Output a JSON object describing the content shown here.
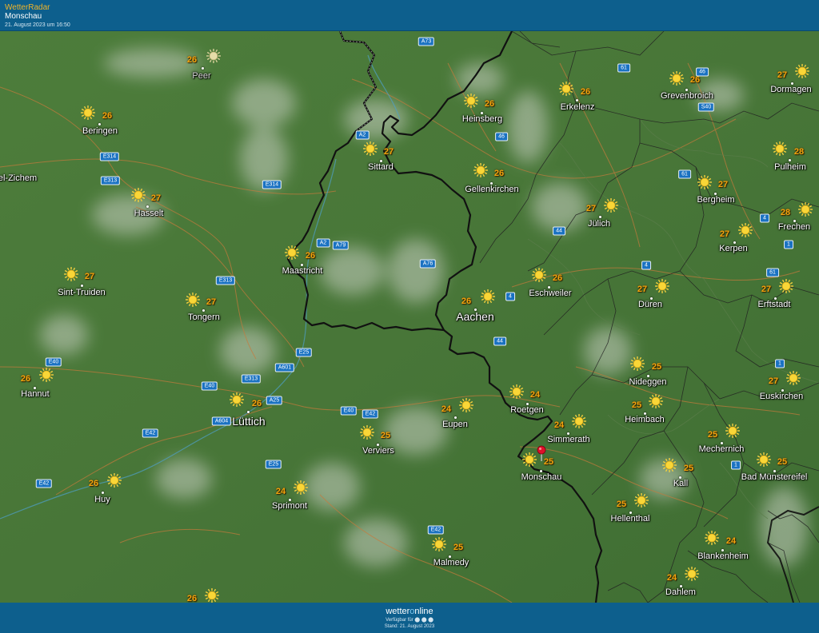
{
  "header": {
    "brand": "WetterRadar",
    "location": "Monschau",
    "date": "21. August 2023 um 16:50"
  },
  "footer": {
    "logo_a": "wetter",
    "logo_b": "o",
    "logo_c": "nline",
    "available": "Verfügbar für ⬤ ⬤ ⬤",
    "stand": "Stand: 21. August 2023"
  },
  "icons": {
    "sun": "sun-icon",
    "pin": "location-pin-icon"
  },
  "colors": {
    "map_green": "#4a7a3a",
    "temp": "#f3a20d",
    "road_badge": "#1a72c2",
    "header": "#0d5f8d",
    "pin": "#e0102a"
  },
  "cities": [
    {
      "name": "Peer",
      "temp": "26",
      "faded": true
    },
    {
      "name": "Beringen",
      "temp": "26"
    },
    {
      "name": "el-Zichem",
      "temp": ""
    },
    {
      "name": "Hasselt",
      "temp": "27"
    },
    {
      "name": "Sint-Truiden",
      "temp": "27"
    },
    {
      "name": "Tongern",
      "temp": "27"
    },
    {
      "name": "Hannut",
      "temp": "26"
    },
    {
      "name": "Huy",
      "temp": "26"
    },
    {
      "name": "Lüttich",
      "temp": "26",
      "big": true
    },
    {
      "name": "Maastricht",
      "temp": "26"
    },
    {
      "name": "Sittard",
      "temp": "27"
    },
    {
      "name": "Heinsberg",
      "temp": "26"
    },
    {
      "name": "Erkelenz",
      "temp": "26"
    },
    {
      "name": "Grevenbroich",
      "temp": "26"
    },
    {
      "name": "Dormagen",
      "temp": "27"
    },
    {
      "name": "Gellenkirchen",
      "temp": "26"
    },
    {
      "name": "Pulheim",
      "temp": "28"
    },
    {
      "name": "Bergheim",
      "temp": "27"
    },
    {
      "name": "Frechen",
      "temp": "28"
    },
    {
      "name": "Jülich",
      "temp": "27"
    },
    {
      "name": "Kerpen",
      "temp": "27"
    },
    {
      "name": "Aachen",
      "temp": "26",
      "big": true
    },
    {
      "name": "Eschweiler",
      "temp": "26"
    },
    {
      "name": "Düren",
      "temp": "27"
    },
    {
      "name": "Erftstadt",
      "temp": "27"
    },
    {
      "name": "Nideggen",
      "temp": "25"
    },
    {
      "name": "Euskirchen",
      "temp": "27"
    },
    {
      "name": "Heimbach",
      "temp": "25"
    },
    {
      "name": "Roetgen",
      "temp": "24"
    },
    {
      "name": "Eupen",
      "temp": "24"
    },
    {
      "name": "Verviers",
      "temp": "25"
    },
    {
      "name": "Simmerath",
      "temp": "24"
    },
    {
      "name": "Monschau",
      "temp": "25"
    },
    {
      "name": "Mechernich",
      "temp": "25"
    },
    {
      "name": "Kall",
      "temp": "25"
    },
    {
      "name": "Bad Münstereifel",
      "temp": "25"
    },
    {
      "name": "Sprimont",
      "temp": "24"
    },
    {
      "name": "Hellenthal",
      "temp": "25"
    },
    {
      "name": "Malmedy",
      "temp": "25"
    },
    {
      "name": "Blankenheim",
      "temp": "24"
    },
    {
      "name": "Dahlem",
      "temp": "24"
    },
    {
      "name": "",
      "temp": "26"
    }
  ],
  "roads": [
    "A73",
    "61",
    "46",
    "S40",
    "A2",
    "46",
    "E314",
    "E313",
    "E314",
    "61",
    "44",
    "4",
    "A2",
    "A79",
    "A76",
    "1",
    "E313",
    "4",
    "61",
    "4",
    "44",
    "E25",
    "A601",
    "E40",
    "E313",
    "E40",
    "A25",
    "A604",
    "E40",
    "E42",
    "E42",
    "1",
    "E25",
    "E42",
    "1",
    "E42"
  ]
}
